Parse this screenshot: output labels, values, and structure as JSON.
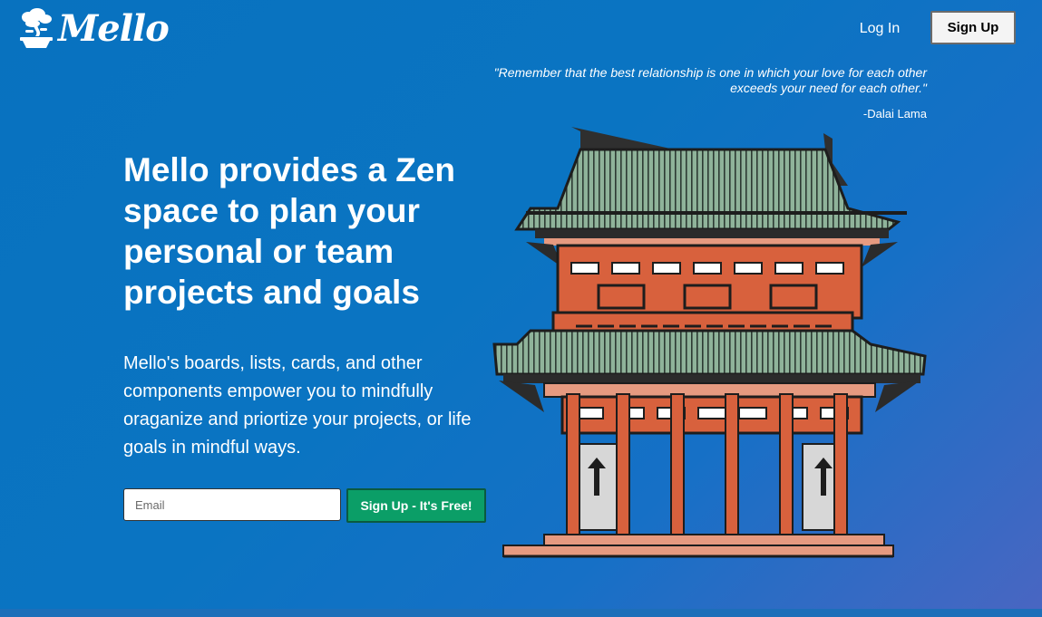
{
  "brand": {
    "name": "Mello",
    "logo_icon": "bonsai-tree-icon"
  },
  "nav": {
    "login_label": "Log In",
    "signup_label": "Sign Up"
  },
  "quote": {
    "text": "\"Remember that the best relationship is one in which your love for each other exceeds your need for each other.\"",
    "author": "-Dalai Lama"
  },
  "hero": {
    "headline": "Mello provides a Zen space to plan your personal or team projects and goals",
    "description": "Mello's boards, lists, cards, and other components empower you to mindfully oraganize and priortize your projects, or life goals in mindful ways.",
    "email_placeholder": "Email",
    "email_value": "",
    "cta_label": "Sign Up - It's Free!",
    "illustration": "japanese-temple-gate-illustration"
  },
  "colors": {
    "background_start": "#0872bf",
    "background_end": "#4966c2",
    "cta_green": "#0b9e67",
    "signup_button_bg": "#f4f4f4"
  }
}
